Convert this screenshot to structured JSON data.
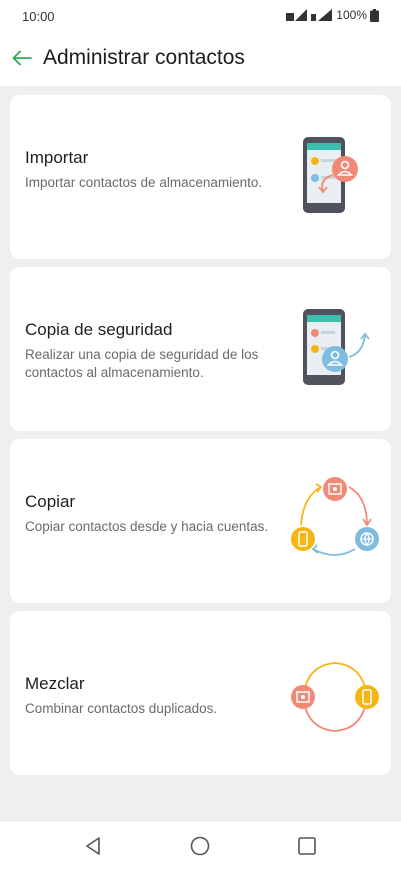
{
  "status": {
    "time": "10:00",
    "battery": "100%"
  },
  "appbar": {
    "title": "Administrar contactos"
  },
  "options": [
    {
      "title": "Importar",
      "description": "Importar contactos de almacenamiento."
    },
    {
      "title": "Copia de seguridad",
      "description": "Realizar una copia de seguridad de los contactos al almacenamiento."
    },
    {
      "title": "Copiar",
      "description": "Copiar contactos desde y hacia cuentas."
    },
    {
      "title": "Mezclar",
      "description": "Combinar contactos duplicados."
    }
  ],
  "colors": {
    "accent": "#2eaa5a",
    "coral": "#f08a76",
    "blue": "#7fbce0",
    "yellow": "#f5b614",
    "phone": "#50535e",
    "screen": "#e9eef2"
  }
}
